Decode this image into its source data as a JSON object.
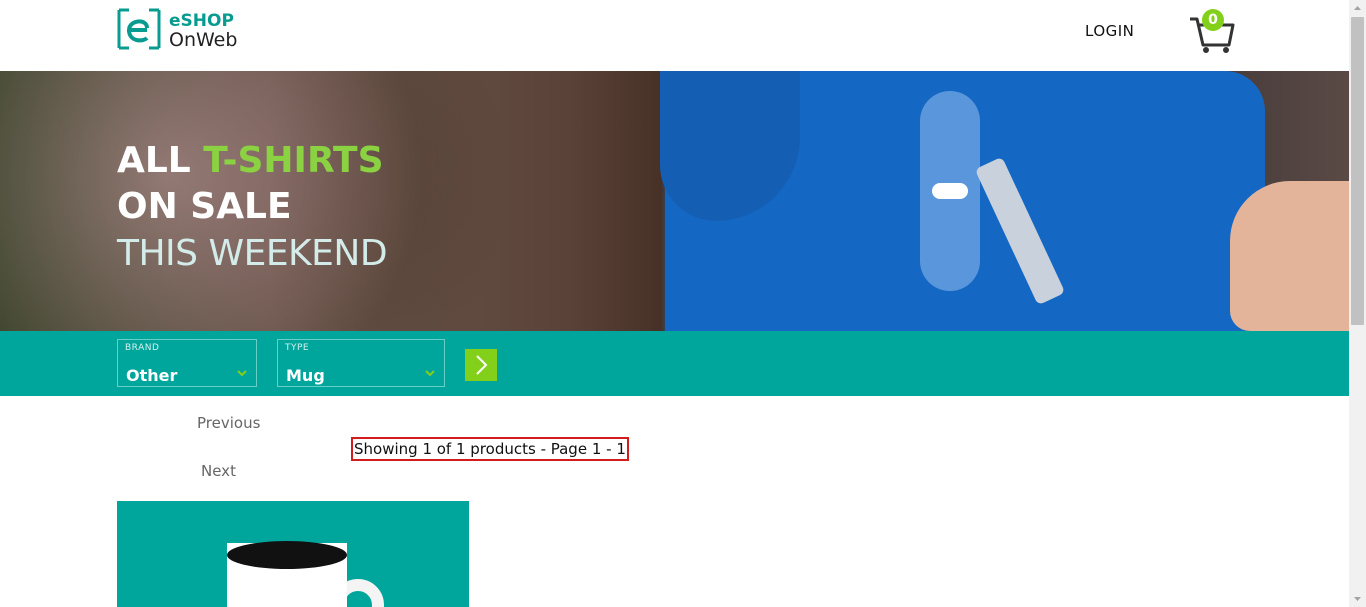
{
  "header": {
    "logo_line1": "eSHOP",
    "logo_line2": "OnWeb",
    "login_label": "LOGIN",
    "cart_count": "0"
  },
  "hero": {
    "line1_prefix": "ALL ",
    "line1_highlight": "T-SHIRTS",
    "line2": "ON SALE",
    "line3": "THIS WEEKEND"
  },
  "filters": {
    "brand_label": "BRAND",
    "brand_value": "Other",
    "type_label": "TYPE",
    "type_value": "Mug"
  },
  "pager": {
    "previous_label": "Previous",
    "next_label": "Next",
    "showing_text": "Showing 1 of 1 products - Page 1 - 1"
  },
  "colors": {
    "teal": "#00a69c",
    "green_accent": "#83d01b",
    "highlight_border": "#d31d1d"
  }
}
